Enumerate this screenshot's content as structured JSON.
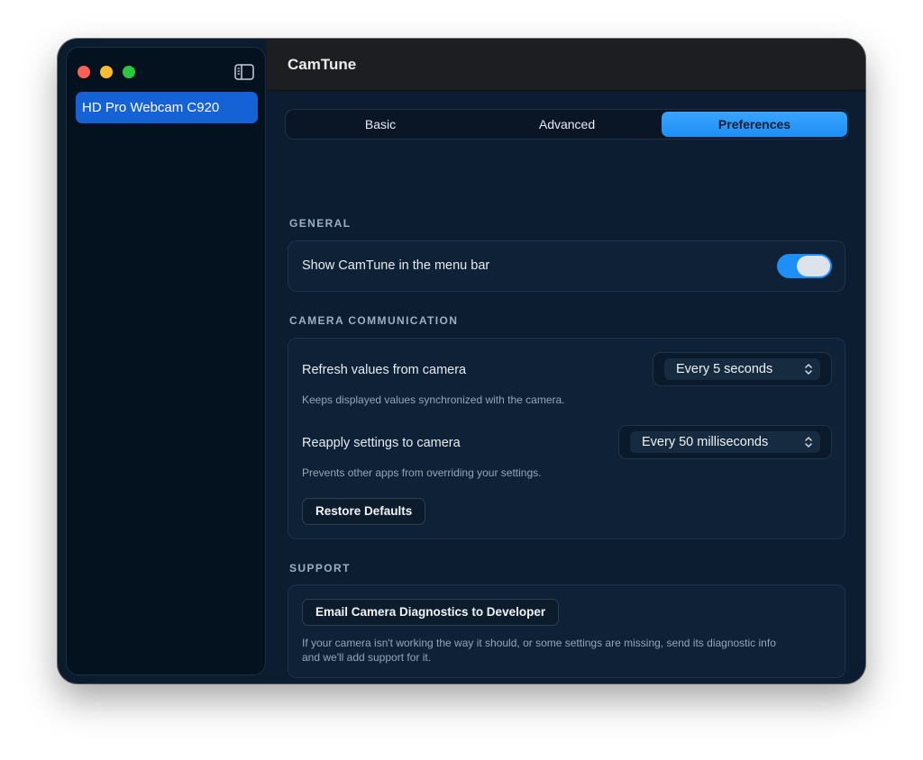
{
  "app": {
    "title": "CamTune"
  },
  "sidebar": {
    "items": [
      {
        "label": "HD Pro Webcam C920",
        "selected": true
      }
    ]
  },
  "tabs": [
    {
      "label": "Basic",
      "selected": false
    },
    {
      "label": "Advanced",
      "selected": false
    },
    {
      "label": "Preferences",
      "selected": true
    }
  ],
  "general": {
    "heading": "GENERAL",
    "menu_bar_label": "Show CamTune in the menu bar",
    "menu_bar_enabled": true
  },
  "camera_communication": {
    "heading": "CAMERA COMMUNICATION",
    "refresh_label": "Refresh values from camera",
    "refresh_value": "Every 5 seconds",
    "refresh_help": "Keeps displayed values synchronized with the camera.",
    "reapply_label": "Reapply settings to camera",
    "reapply_value": "Every 50 milliseconds",
    "reapply_help": "Prevents other apps from overriding your settings.",
    "restore_button": "Restore Defaults"
  },
  "support": {
    "heading": "SUPPORT",
    "email_button": "Email Camera Diagnostics to Developer",
    "help_line1": "If your camera isn't working the way it should, or some settings are missing, send its diagnostic info",
    "help_line2": "and we'll add support for it."
  },
  "colors": {
    "accent": "#1e8ff6",
    "selection": "#1561d6",
    "traffic_close": "#fe5f57",
    "traffic_minimize": "#febc2e",
    "traffic_zoom": "#28c840"
  },
  "icons": [
    "sidebar-toggle-icon",
    "chevron-up-down-icon"
  ]
}
